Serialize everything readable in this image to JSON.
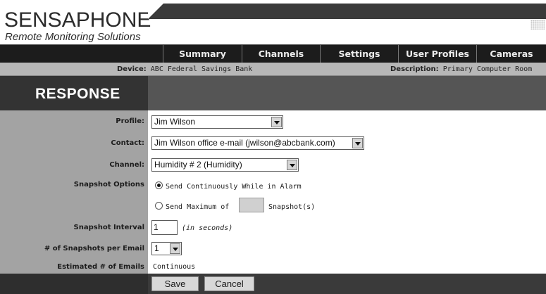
{
  "brand": {
    "name": "SENSAPHONE",
    "trademark": "®",
    "tagline": "Remote Monitoring Solutions"
  },
  "nav": [
    "Summary",
    "Channels",
    "Settings",
    "User Profiles",
    "Cameras"
  ],
  "device": {
    "label": "Device:",
    "value": "ABC Federal Savings Bank"
  },
  "description": {
    "label": "Description:",
    "value": "Primary Computer Room"
  },
  "section_title": "RESPONSE",
  "form": {
    "profile": {
      "label": "Profile:",
      "value": "Jim Wilson"
    },
    "contact": {
      "label": "Contact:",
      "value": "Jim Wilson office e-mail (jwilson@abcbank.com)"
    },
    "channel": {
      "label": "Channel:",
      "value": "Humidity # 2 (Humidity)"
    },
    "snapshot_options": {
      "label": "Snapshot Options",
      "option_continuous": "Send Continuously While in Alarm",
      "option_max_prefix": "Send Maximum of",
      "option_max_suffix": "Snapshot(s)",
      "max_value": "",
      "selected": "continuous"
    },
    "snapshot_interval": {
      "label": "Snapshot Interval",
      "value": "1",
      "hint": "(in seconds)"
    },
    "snapshots_per_email": {
      "label": "# of Snapshots per Email",
      "value": "1"
    },
    "estimated_emails": {
      "label": "Estimated # of Emails",
      "value": "Continuous"
    }
  },
  "buttons": {
    "save": "Save",
    "cancel": "Cancel"
  },
  "colors": {
    "nav_bg": "#1c1c1c",
    "panel_left": "#a3a3a3",
    "strip": "#b7b7b7",
    "band": "#333333"
  }
}
